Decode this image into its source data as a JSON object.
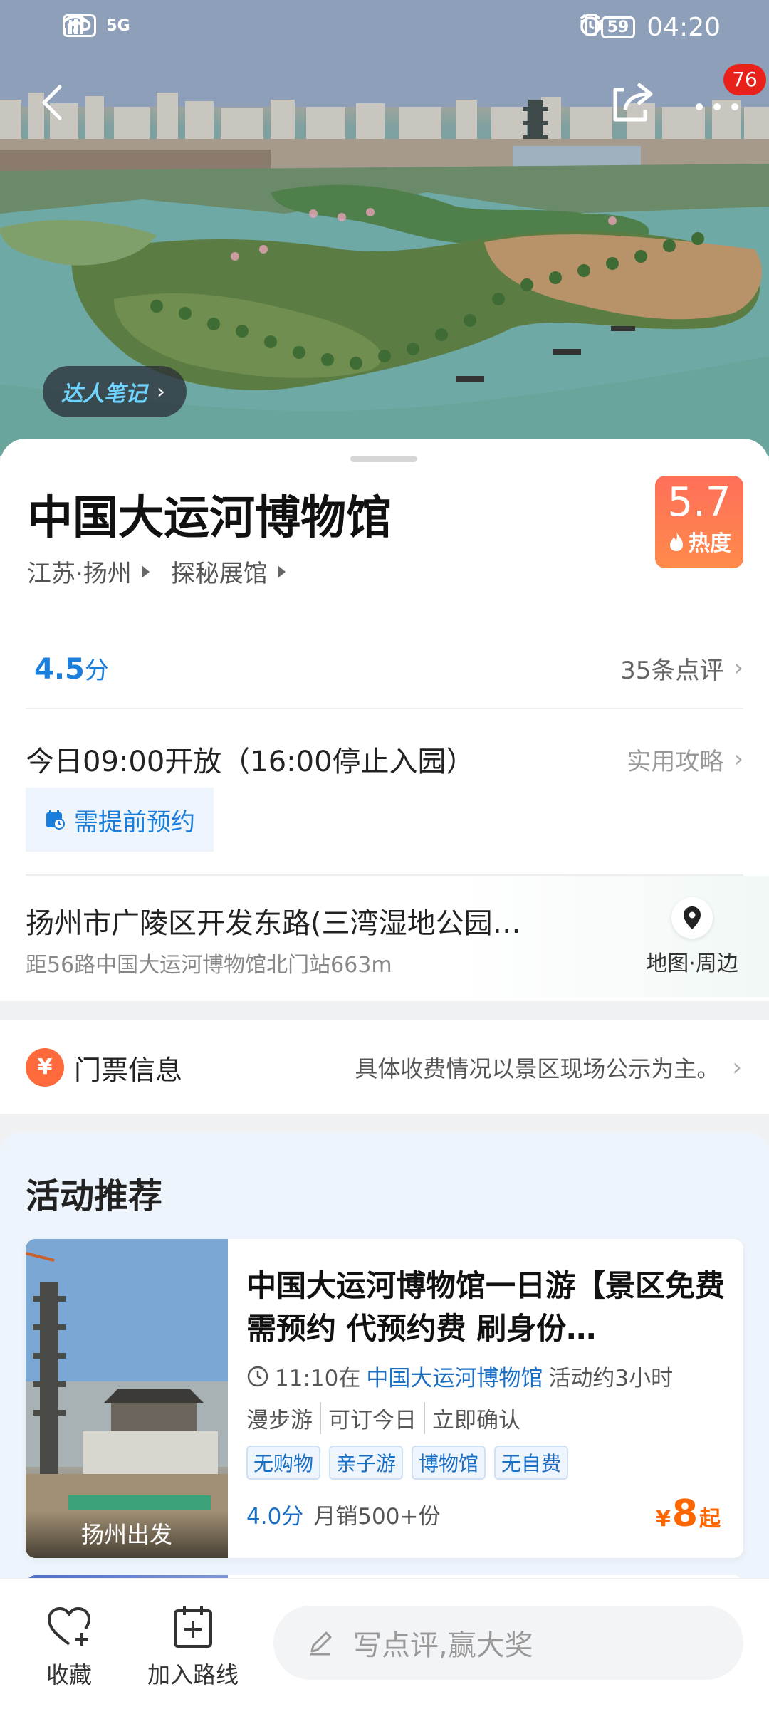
{
  "status_bar": {
    "hd": "HD",
    "network": "5G",
    "battery": "59",
    "time": "04:20"
  },
  "top_nav": {
    "notification_count": "76"
  },
  "hero": {
    "note_label": "达人笔记"
  },
  "poi": {
    "name": "中国大运河博物馆",
    "region": "江苏·扬州",
    "category": "探秘展馆",
    "heat_value": "5.7",
    "heat_label": "热度",
    "rating": "4.5",
    "rating_unit": "分",
    "review_count": "35条点评",
    "hours": "今日09:00开放（16:00停止入园）",
    "guide_link": "实用攻略",
    "reservation": "需提前预约",
    "address": "扬州市广陵区开发东路(三湾湿地公园…",
    "distance": "距56路中国大运河博物馆北门站663m",
    "map_label": "地图·周边"
  },
  "ticket": {
    "title": "门票信息",
    "icon_text": "¥",
    "note": "具体收费情况以景区现场公示为主。"
  },
  "activities": {
    "section_title": "活动推荐",
    "items": [
      {
        "name": "中国大运河博物馆一日游【景区免费需预约  代预约费  刷身份…",
        "time_prefix": "11:10在",
        "time_place": "中国大运河博物馆",
        "time_suffix": "活动约3小时",
        "features": [
          "漫步游",
          "可订今日",
          "立即确认"
        ],
        "tags": [
          "无购物",
          "亲子游",
          "博物馆",
          "无自费"
        ],
        "score": "4.0分",
        "sales": "月销500+份",
        "price_currency": "¥",
        "price": "8",
        "price_suffix": "起",
        "departure": "扬州出发"
      }
    ]
  },
  "bottom_bar": {
    "favorite": "收藏",
    "add_route": "加入路线",
    "review_placeholder": "写点评,赢大奖"
  },
  "colors": {
    "accent_blue": "#1a7fdc",
    "heat_orange": "#ff7a52",
    "price_orange": "#ff6600",
    "badge_red": "#e8221b"
  }
}
